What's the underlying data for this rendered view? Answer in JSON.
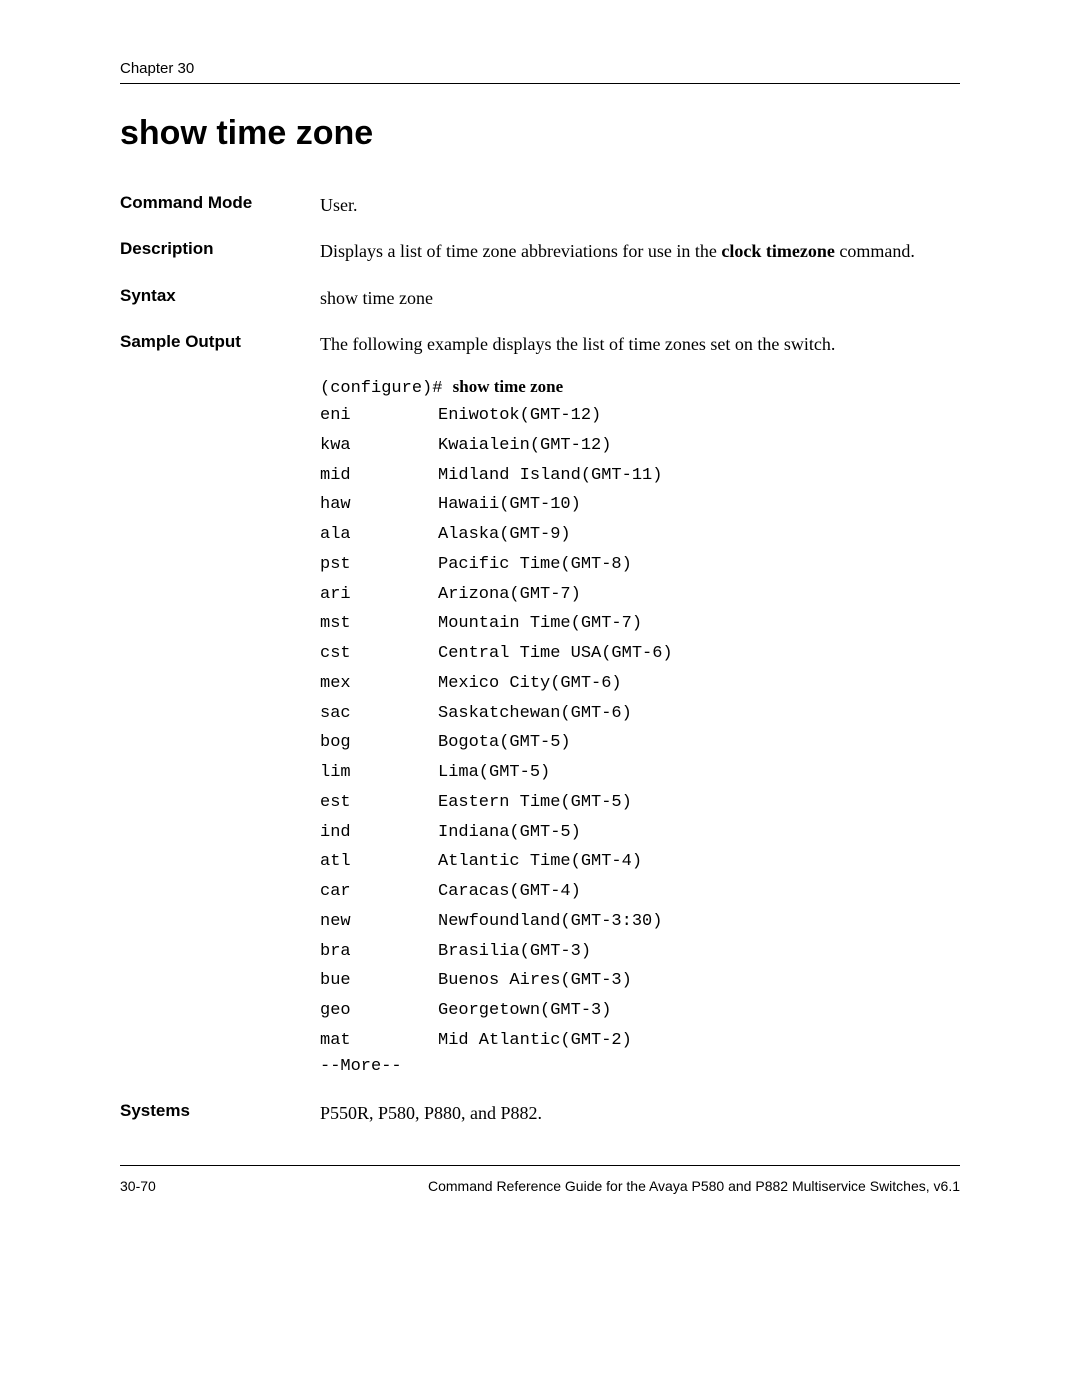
{
  "chapter": "Chapter 30",
  "title": "show time zone",
  "sections": {
    "command_mode": {
      "label": "Command Mode",
      "value": "User."
    },
    "description": {
      "label": "Description",
      "value_pre": "Displays a list of time zone abbreviations for use in the ",
      "value_bold": "clock timezone",
      "value_post": " command."
    },
    "syntax": {
      "label": "Syntax",
      "value": "show time zone"
    },
    "sample_output": {
      "label": "Sample Output",
      "intro": "The following example displays the list of time zones set on the switch.",
      "prompt": "(configure)# ",
      "command": "show time zone",
      "timezones": [
        {
          "abbr": "eni",
          "desc": "Eniwotok(GMT-12)"
        },
        {
          "abbr": "kwa",
          "desc": "Kwaialein(GMT-12)"
        },
        {
          "abbr": "mid",
          "desc": "Midland Island(GMT-11)"
        },
        {
          "abbr": "haw",
          "desc": "Hawaii(GMT-10)"
        },
        {
          "abbr": "ala",
          "desc": "Alaska(GMT-9)"
        },
        {
          "abbr": "pst",
          "desc": "Pacific Time(GMT-8)"
        },
        {
          "abbr": "ari",
          "desc": "Arizona(GMT-7)"
        },
        {
          "abbr": "mst",
          "desc": "Mountain Time(GMT-7)"
        },
        {
          "abbr": "cst",
          "desc": "Central Time USA(GMT-6)"
        },
        {
          "abbr": "mex",
          "desc": "Mexico City(GMT-6)"
        },
        {
          "abbr": "sac",
          "desc": "Saskatchewan(GMT-6)"
        },
        {
          "abbr": "bog",
          "desc": "Bogota(GMT-5)"
        },
        {
          "abbr": "lim",
          "desc": "Lima(GMT-5)"
        },
        {
          "abbr": "est",
          "desc": "Eastern Time(GMT-5)"
        },
        {
          "abbr": "ind",
          "desc": "Indiana(GMT-5)"
        },
        {
          "abbr": "atl",
          "desc": "Atlantic Time(GMT-4)"
        },
        {
          "abbr": "car",
          "desc": "Caracas(GMT-4)"
        },
        {
          "abbr": "new",
          "desc": "Newfoundland(GMT-3:30)"
        },
        {
          "abbr": "bra",
          "desc": "Brasilia(GMT-3)"
        },
        {
          "abbr": "bue",
          "desc": "Buenos Aires(GMT-3)"
        },
        {
          "abbr": "geo",
          "desc": "Georgetown(GMT-3)"
        },
        {
          "abbr": "mat",
          "desc": "Mid Atlantic(GMT-2)"
        }
      ],
      "more": "--More--"
    },
    "systems": {
      "label": "Systems",
      "value": "P550R, P580, P880, and P882."
    }
  },
  "footer": {
    "page": "30-70",
    "doc": "Command Reference Guide for the Avaya P580 and P882 Multiservice Switches, v6.1"
  }
}
